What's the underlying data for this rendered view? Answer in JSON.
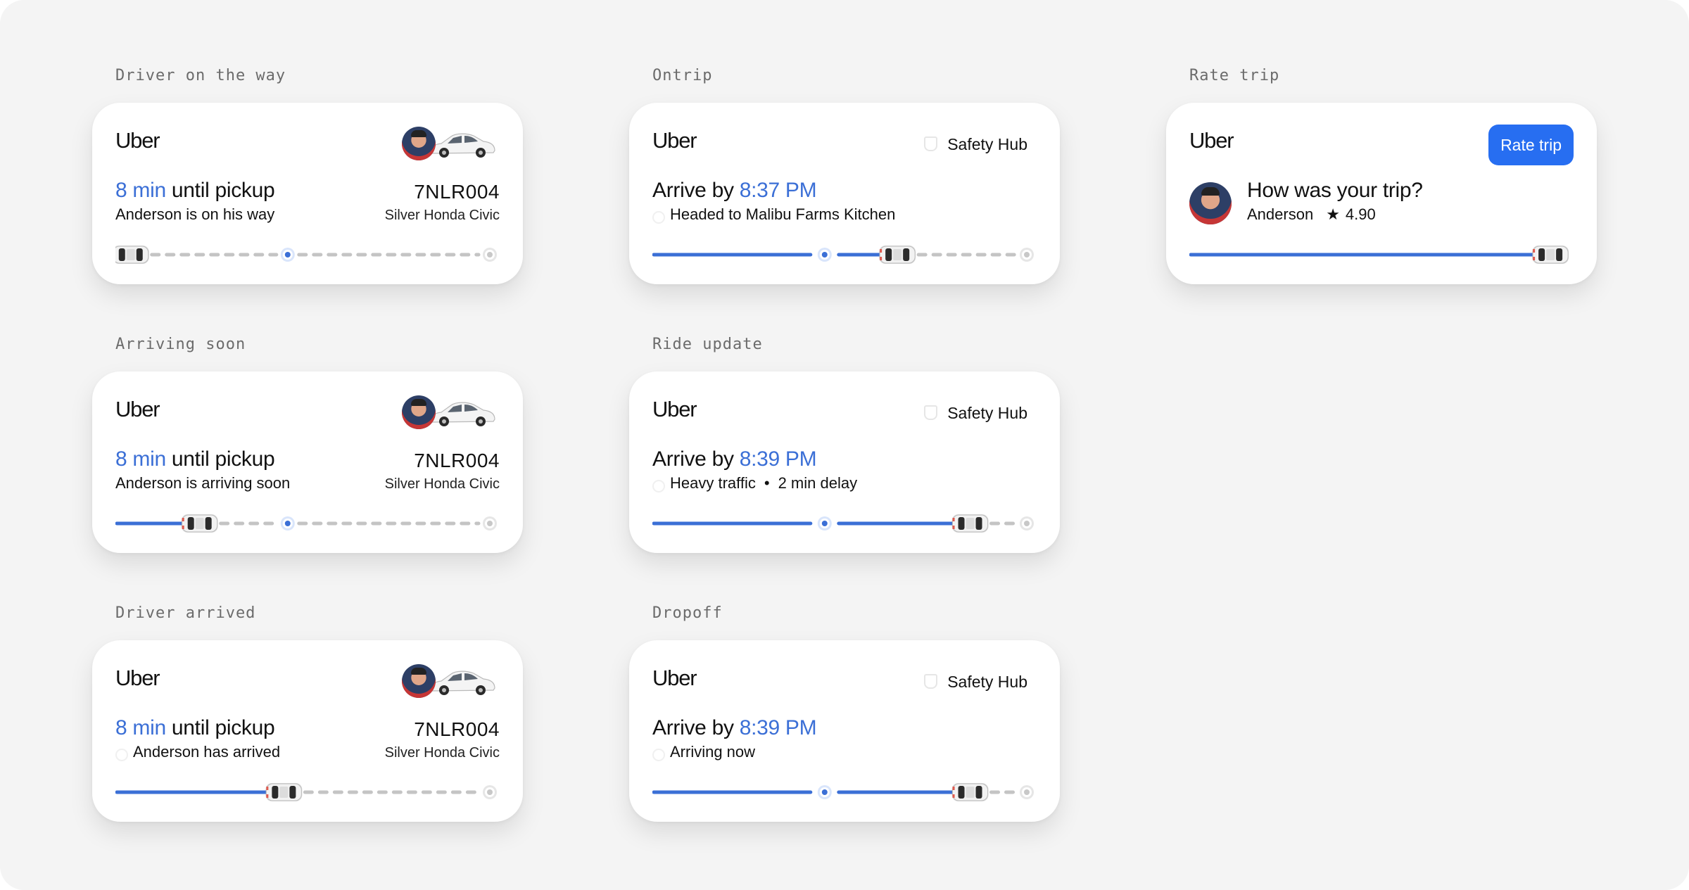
{
  "colors": {
    "accent": "#3b6fd6",
    "button": "#276ef1",
    "dash": "#c4c4c4",
    "background": "#f4f4f4"
  },
  "cards": [
    {
      "id": "driver-on-the-way",
      "section": "Driver on the way",
      "brand": "Uber",
      "type": "pickup",
      "eta": "8 min",
      "eta_suffix": " until pickup",
      "plate": "7NLR004",
      "car_model": "Silver Honda Civic",
      "sub_text": "Anderson is on his way",
      "sub_icon": false,
      "progress": {
        "mode": "pickup",
        "car_fraction": 0.04,
        "pickup_fraction": 0.45
      }
    },
    {
      "id": "arriving-soon",
      "section": "Arriving soon",
      "brand": "Uber",
      "type": "pickup",
      "eta": "8 min",
      "eta_suffix": " until pickup",
      "plate": "7NLR004",
      "car_model": "Silver Honda Civic",
      "sub_text": "Anderson is arriving soon",
      "sub_icon": false,
      "progress": {
        "mode": "pickup",
        "car_fraction": 0.22,
        "pickup_fraction": 0.45
      }
    },
    {
      "id": "driver-arrived",
      "section": "Driver arrived",
      "brand": "Uber",
      "type": "pickup",
      "eta": "8 min",
      "eta_suffix": " until pickup",
      "plate": "7NLR004",
      "car_model": "Silver Honda Civic",
      "sub_text": "Anderson has arrived",
      "sub_icon": true,
      "progress": {
        "mode": "arrived",
        "car_fraction": 0.44
      }
    },
    {
      "id": "ontrip",
      "section": "Ontrip",
      "brand": "Uber",
      "type": "trip",
      "safety_label": "Safety Hub",
      "arrive_prefix": "Arrive by ",
      "arrive_time": "8:37 PM",
      "sub_text": "Headed to Malibu Farms Kitchen",
      "sub_icon": true,
      "progress": {
        "mode": "trip",
        "stop_fraction": 0.45,
        "car_fraction": 0.64
      }
    },
    {
      "id": "ride-update",
      "section": "Ride update",
      "brand": "Uber",
      "type": "trip",
      "safety_label": "Safety Hub",
      "arrive_prefix": "Arrive by ",
      "arrive_time": "8:39 PM",
      "sub_text": "Heavy traffic",
      "sub_extra": "2 min delay",
      "sub_icon": true,
      "progress": {
        "mode": "trip",
        "stop_fraction": 0.45,
        "car_fraction": 0.83
      }
    },
    {
      "id": "dropoff",
      "section": "Dropoff",
      "brand": "Uber",
      "type": "trip",
      "safety_label": "Safety Hub",
      "arrive_prefix": "Arrive by ",
      "arrive_time": "8:39 PM",
      "sub_text": "Arriving now",
      "sub_icon": true,
      "progress": {
        "mode": "trip",
        "stop_fraction": 0.45,
        "car_fraction": 0.83
      }
    },
    {
      "id": "rate-trip",
      "section": "Rate trip",
      "brand": "Uber",
      "type": "rate",
      "rate_button": "Rate trip",
      "question": "How was your trip?",
      "driver_name": "Anderson",
      "rating": "4.90",
      "progress": {
        "mode": "complete",
        "car_fraction": 0.98
      }
    }
  ]
}
